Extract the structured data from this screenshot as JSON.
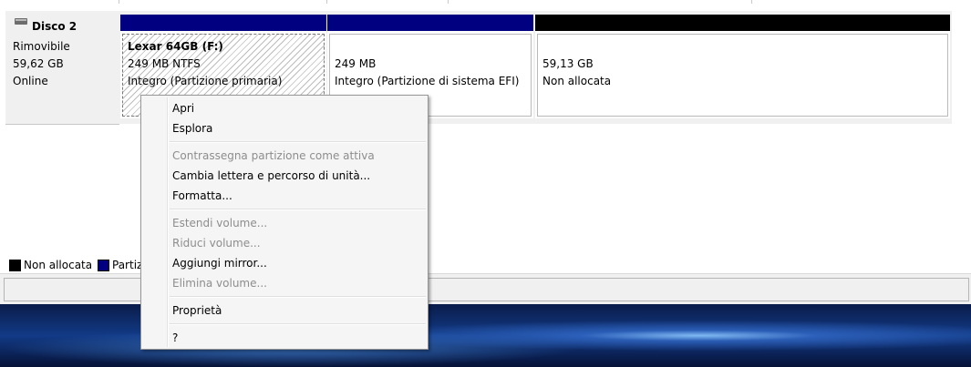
{
  "disk": {
    "name": "Disco 2",
    "type": "Rimovibile",
    "size": "59,62 GB",
    "status": "Online"
  },
  "partitions": [
    {
      "title": "Lexar 64GB  (F:)",
      "size": "249 MB NTFS",
      "status": "Integro (Partizione primaria)",
      "bar_color": "#000080"
    },
    {
      "title": "",
      "size": "249 MB",
      "status": "Integro (Partizione di sistema EFI)",
      "bar_color": "#000080"
    },
    {
      "title": "",
      "size": "59,13 GB",
      "status": "Non allocata",
      "bar_color": "#000000"
    }
  ],
  "legend": [
    {
      "label": "Non allocata",
      "color": "#000000"
    },
    {
      "label": "Partiz",
      "color": "#000080"
    }
  ],
  "context_menu": {
    "items": [
      {
        "label": "Apri",
        "enabled": true
      },
      {
        "label": "Esplora",
        "enabled": true
      },
      {
        "label": "Contrassegna partizione come attiva",
        "enabled": false
      },
      {
        "label": "Cambia lettera e percorso di unità...",
        "enabled": true
      },
      {
        "label": "Formatta...",
        "enabled": true
      },
      {
        "label": "Estendi volume...",
        "enabled": false
      },
      {
        "label": "Riduci volume...",
        "enabled": false
      },
      {
        "label": "Aggiungi mirror...",
        "enabled": true
      },
      {
        "label": "Elimina volume...",
        "enabled": false
      },
      {
        "label": "Proprietà",
        "enabled": true
      },
      {
        "label": "?",
        "enabled": true
      }
    ]
  },
  "icons": {
    "disk": "removable-disk-icon"
  }
}
